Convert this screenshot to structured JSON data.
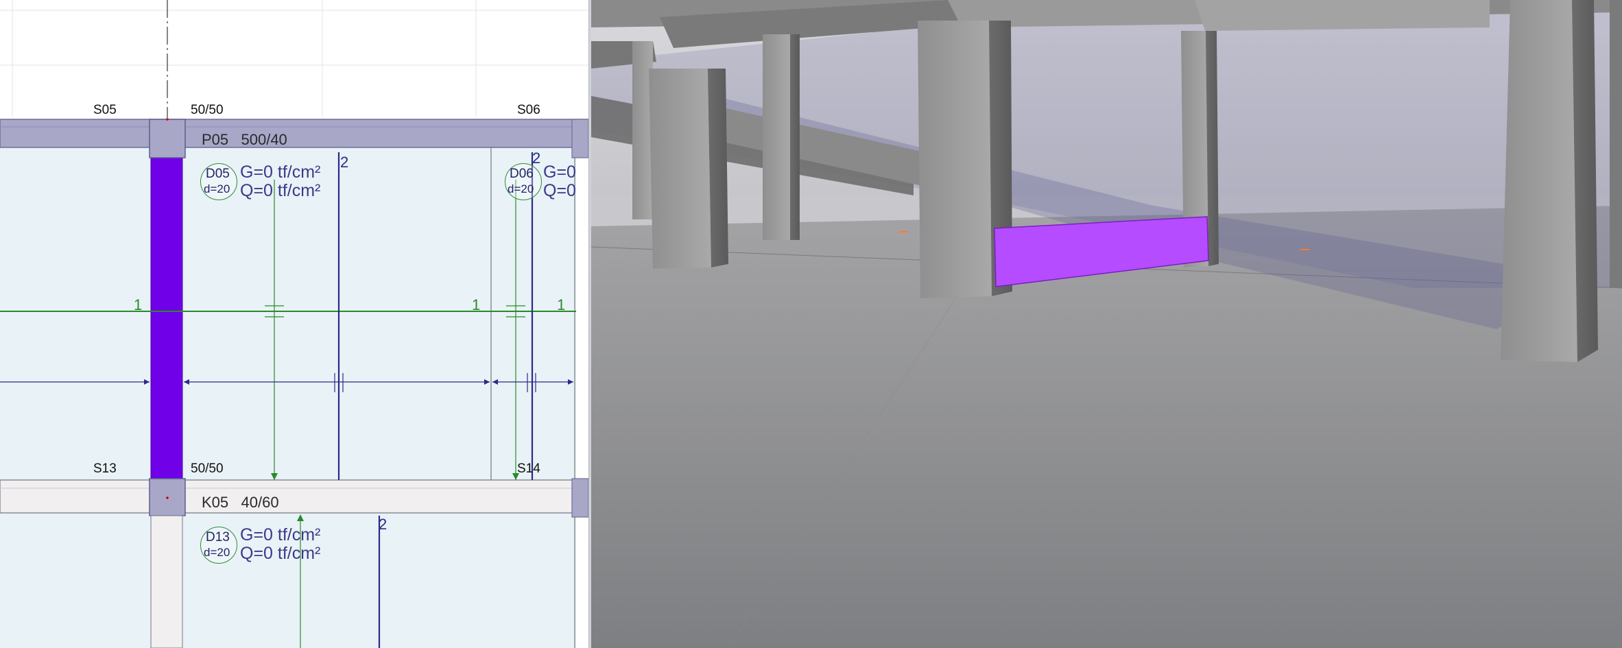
{
  "plan": {
    "columns": [
      {
        "name": "S05",
        "size": "50/50"
      },
      {
        "name": "S06"
      },
      {
        "name": "S13",
        "size": "50/50"
      },
      {
        "name": "S14"
      }
    ],
    "beams": [
      {
        "name": "P05",
        "section": "500/40"
      },
      {
        "name": "K05",
        "section": "40/60"
      }
    ],
    "slabs": [
      {
        "id": "D05",
        "thickness": "d=20",
        "g_load": "G=0 tf/cm²",
        "q_load": "Q=0 tf/cm²",
        "span_dir": "2"
      },
      {
        "id": "D06",
        "thickness": "d=20",
        "g_load": "G=0",
        "q_load": "Q=0",
        "span_dir": "2"
      },
      {
        "id": "D13",
        "thickness": "d=20",
        "g_load": "G=0 tf/cm²",
        "q_load": "Q=0 tf/cm²",
        "span_dir": "2"
      }
    ],
    "axis_labels": [
      "1",
      "1",
      "1"
    ],
    "colors": {
      "slab_fill": "#e9f2f6",
      "beam_fill": "#a8a7c8",
      "selected_column": "#6f00e8",
      "axis_green": "#2a8a2a",
      "dimension_blue": "#2a2a8a"
    }
  },
  "view3d": {
    "colors": {
      "selected_beam": "#b64cff",
      "concrete": "#8b8b8b",
      "ghost_slab": "#6a6aa0"
    }
  }
}
